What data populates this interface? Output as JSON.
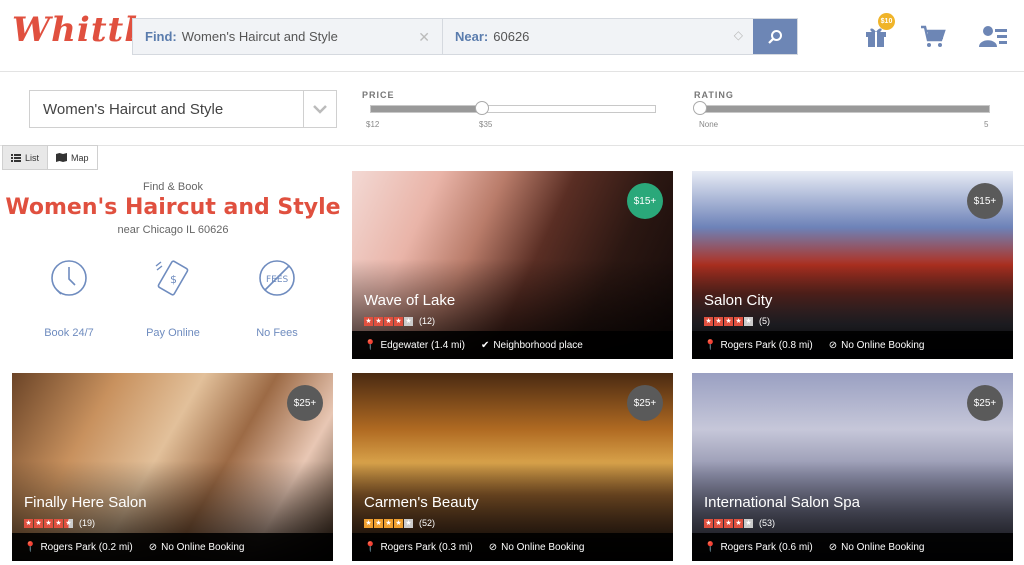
{
  "header": {
    "logo": "Whittl",
    "find_label": "Find:",
    "find_value": "Women's Haircut and Style",
    "near_label": "Near:",
    "near_value": "60626",
    "gift_badge": "$10"
  },
  "filters": {
    "category": "Women's Haircut and Style",
    "price": {
      "label": "PRICE",
      "min_label": "$12",
      "value_label": "$35",
      "value": 0.39
    },
    "rating": {
      "label": "RATING",
      "min_label": "None",
      "max_label": "5",
      "value": 0
    }
  },
  "view_toggle": {
    "list": "List",
    "map": "Map"
  },
  "intro": {
    "find_book": "Find & Book",
    "title": "Women's Haircut and Style",
    "near": "near Chicago IL 60626",
    "features": [
      "Book 24/7",
      "Pay Online",
      "No Fees"
    ]
  },
  "cards": [
    {
      "name": "Wave of Lake",
      "rating": 4,
      "reviews": "(12)",
      "location": "Edgewater (1.4 mi)",
      "extra": "Neighborhood place",
      "extra_icon": "check-icon",
      "price": "$15+",
      "price_color": "#2aa87a",
      "star_color": "#e0503f"
    },
    {
      "name": "Salon City",
      "rating": 4,
      "reviews": "(5)",
      "location": "Rogers Park (0.8 mi)",
      "extra": "No Online Booking",
      "extra_icon": "no-booking-icon",
      "price": "$15+",
      "price_color": "#5a5a5a",
      "star_color": "#e0503f"
    },
    {
      "name": "Finally Here Salon",
      "rating": 4.5,
      "reviews": "(19)",
      "location": "Rogers Park (0.2 mi)",
      "extra": "No Online Booking",
      "extra_icon": "no-booking-icon",
      "price": "$25+",
      "price_color": "#5a5a5a",
      "star_color": "#e0503f"
    },
    {
      "name": "Carmen's Beauty",
      "rating": 4,
      "reviews": "(52)",
      "location": "Rogers Park (0.3 mi)",
      "extra": "No Online Booking",
      "extra_icon": "no-booking-icon",
      "price": "$25+",
      "price_color": "#5a5a5a",
      "star_color": "#f0a030"
    },
    {
      "name": "International Salon Spa",
      "rating": 4,
      "reviews": "(53)",
      "location": "Rogers Park (0.6 mi)",
      "extra": "No Online Booking",
      "extra_icon": "no-booking-icon",
      "price": "$25+",
      "price_color": "#5a5a5a",
      "star_color": "#e0503f"
    }
  ]
}
